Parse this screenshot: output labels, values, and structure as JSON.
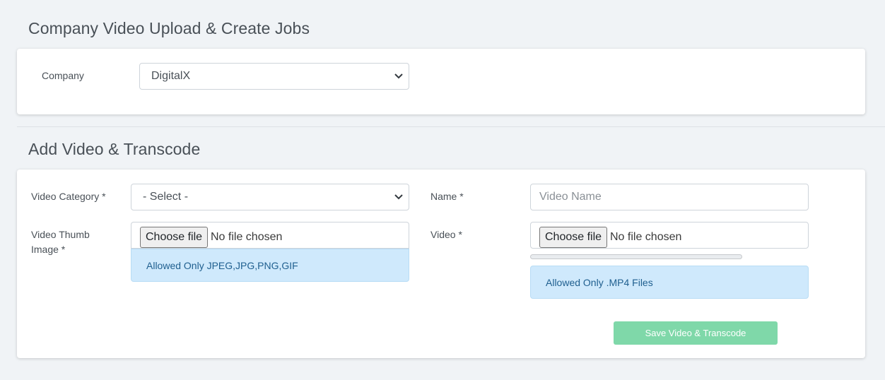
{
  "sections": {
    "company_upload_title": "Company Video Upload & Create Jobs",
    "add_video_title": "Add Video & Transcode"
  },
  "company": {
    "label": "Company",
    "selected": "DigitalX"
  },
  "form": {
    "category_label": "Video Category *",
    "category_selected": "- Select -",
    "name_label": "Name *",
    "name_placeholder": "Video Name",
    "name_value": "",
    "thumb_label_line1": "Video Thumb",
    "thumb_label_line2": "Image *",
    "thumb_button": "Choose file",
    "thumb_status": "No file chosen",
    "thumb_hint": "Allowed Only JPEG,JPG,PNG,GIF",
    "video_label": "Video *",
    "video_button": "Choose file",
    "video_status": "No file chosen",
    "video_progress": 0,
    "video_hint": "Allowed Only .MP4 Files",
    "save_button": "Save Video & Transcode"
  },
  "colors": {
    "page_bg": "#f0f3f6",
    "alert_bg": "#cfe9fc",
    "save_button_bg": "#7fd8a9"
  }
}
